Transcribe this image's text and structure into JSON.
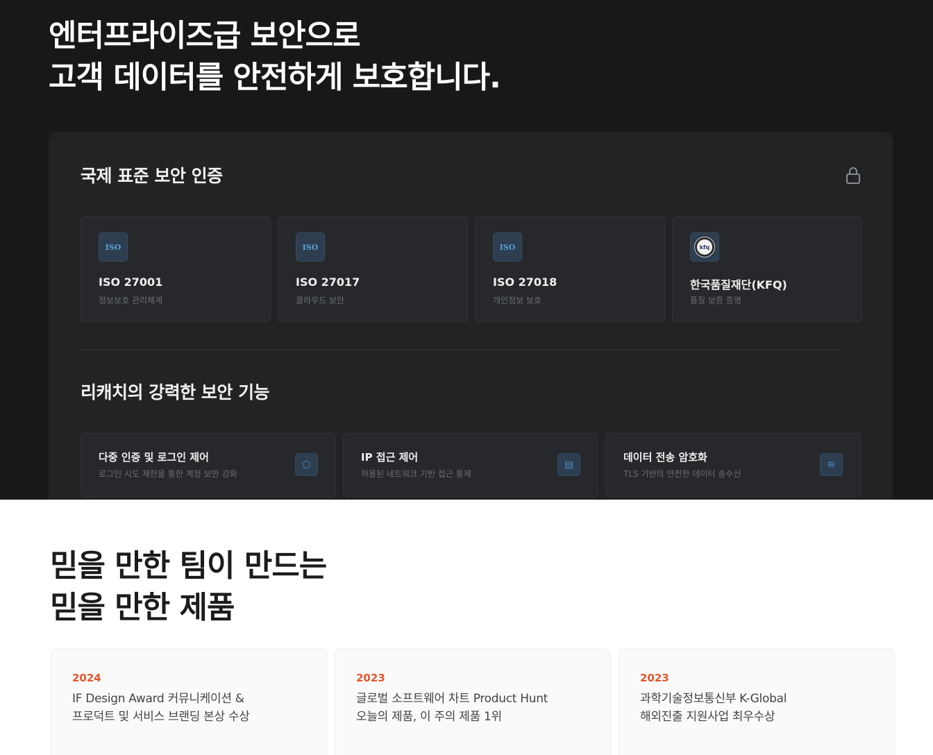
{
  "hero": {
    "title_line1": "엔터프라이즈급 보안으로",
    "title_line2": "고객 데이터를 안전하게 보호합니다."
  },
  "certifications": {
    "heading": "국제 표준 보안 인증",
    "icon": "lock-icon",
    "items": [
      {
        "badge": "ISO",
        "name": "ISO 27001",
        "desc": "정보보호 관리체계"
      },
      {
        "badge": "ISO",
        "name": "ISO 27017",
        "desc": "클라우드 보안"
      },
      {
        "badge": "ISO",
        "name": "ISO 27018",
        "desc": "개인정보 보호"
      },
      {
        "badge": "kfq",
        "name": "한국품질재단(KFQ)",
        "desc": "품질 보증 증명"
      }
    ]
  },
  "features": {
    "heading": "리캐치의 강력한 보안 기능",
    "items": [
      {
        "title": "다중 인증 및 로그인 제어",
        "desc": "로그인 시도 제한을 통한 계정 보안 강화",
        "icon": "shield-icon",
        "glyph": "⬡"
      },
      {
        "title": "IP 접근 제어",
        "desc": "허용된 네트워크 기반 접근 통제",
        "icon": "database-icon",
        "glyph": "▤"
      },
      {
        "title": "데이터 전송 암호화",
        "desc": "TLS 기반의 안전한 데이터 송수신",
        "icon": "rss-icon",
        "glyph": "≋"
      }
    ]
  },
  "trust": {
    "title_line1": "믿을 만한 팀이 만드는",
    "title_line2": "믿을 만한 제품",
    "awards": [
      {
        "year": "2024",
        "line1": "IF Design Award  커뮤니케이션 &",
        "line2": "프로덕트 및 서비스 브랜딩 본상 수상"
      },
      {
        "year": "2023",
        "line1": "글로벌 소프트웨어 차트 Product Hunt",
        "line2": "오늘의 제품, 이 주의 제품 1위"
      },
      {
        "year": "2023",
        "line1": "과학기술정보통신부 K-Global",
        "line2": "해외진출 지원사업 최우수상"
      }
    ]
  },
  "colors": {
    "dark_bg": "#181818",
    "panel_bg": "#212325",
    "accent_blue": "#4f8ec4",
    "award_year": "#e4572e"
  }
}
